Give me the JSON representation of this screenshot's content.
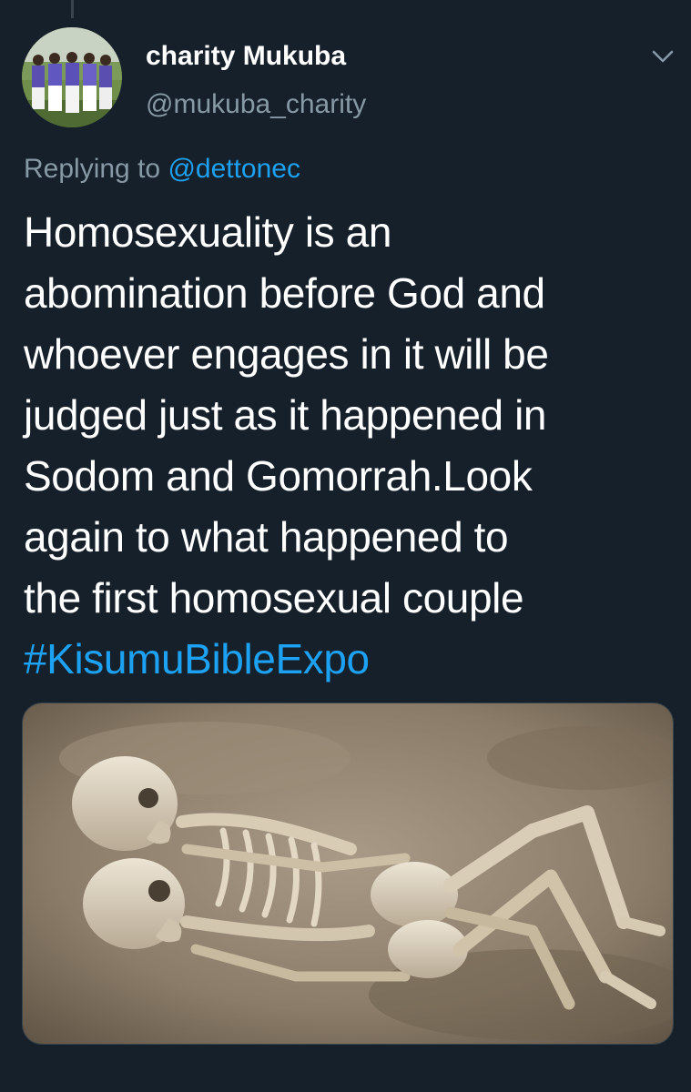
{
  "tweet": {
    "author_name": "charity Mukuba",
    "author_handle": "@mukuba_charity",
    "replying_to_label": "Replying to",
    "replying_to_handle": "@dettonec",
    "text_lines": [
      "Homosexuality is an",
      "abomination before God and",
      "whoever engages in it will be",
      "judged just as it happened in",
      "Sodom and Gomorrah.Look",
      "again to what happened to",
      "the first homosexual couple"
    ],
    "hashtag": "#KisumuBibleExpo",
    "avatar_icon": "group-photo-avatar",
    "menu_icon": "chevron-down-icon",
    "media_description_icon": "photo-skeletons-image"
  },
  "colors": {
    "background": "#16202b",
    "primary_text": "#ffffff",
    "secondary_text": "#8899a6",
    "accent": "#1da1f2",
    "border": "#38444d"
  }
}
